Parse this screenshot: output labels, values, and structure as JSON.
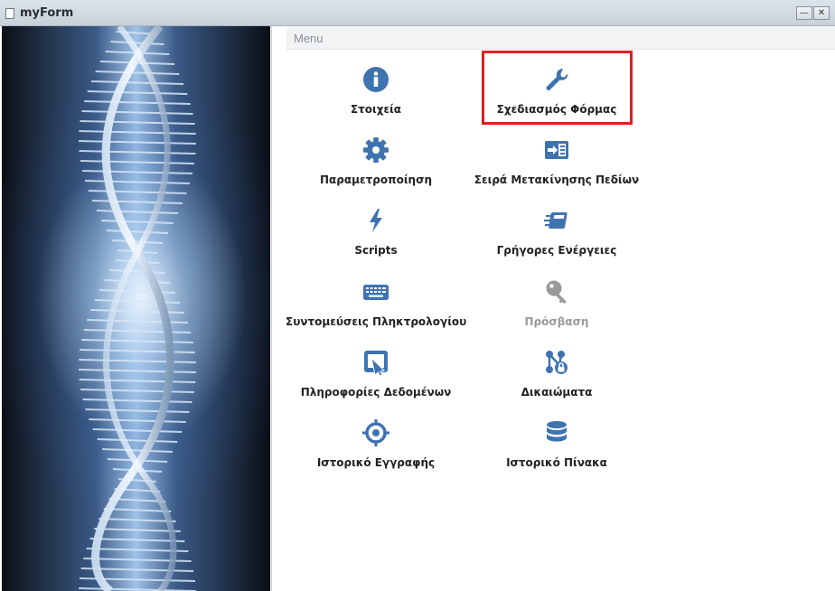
{
  "window": {
    "title": "myForm",
    "minimize_symbol": "—",
    "close_symbol": "✕"
  },
  "menu": {
    "header": "Menu",
    "items": [
      {
        "label": "Στοιχεία",
        "icon": "info-icon",
        "enabled": true
      },
      {
        "label": "Σχεδιασμός Φόρμας",
        "icon": "wrench-icon",
        "enabled": true,
        "highlighted": true
      },
      {
        "label": "Παραμετροποίηση",
        "icon": "gear-icon",
        "enabled": true
      },
      {
        "label": "Σειρά Μετακίνησης Πεδίων",
        "icon": "field-order-icon",
        "enabled": true
      },
      {
        "label": "Scripts",
        "icon": "bolt-icon",
        "enabled": true
      },
      {
        "label": "Γρήγορες Ενέργειες",
        "icon": "quick-actions-icon",
        "enabled": true
      },
      {
        "label": "Συντομεύσεις Πληκτρολογίου",
        "icon": "keyboard-icon",
        "enabled": true
      },
      {
        "label": "Πρόσβαση",
        "icon": "key-icon",
        "enabled": false
      },
      {
        "label": "Πληροφορίες Δεδομένων",
        "icon": "data-info-icon",
        "enabled": true
      },
      {
        "label": "Δικαιώματα",
        "icon": "permissions-icon",
        "enabled": true
      },
      {
        "label": "Ιστορικό Εγγραφής",
        "icon": "target-icon",
        "enabled": true
      },
      {
        "label": "Ιστορικό Πίνακα",
        "icon": "database-icon",
        "enabled": true
      }
    ]
  },
  "colors": {
    "icon": "#3e73b0",
    "icon_disabled": "#9a9a9a",
    "highlight_border": "#e02020"
  }
}
